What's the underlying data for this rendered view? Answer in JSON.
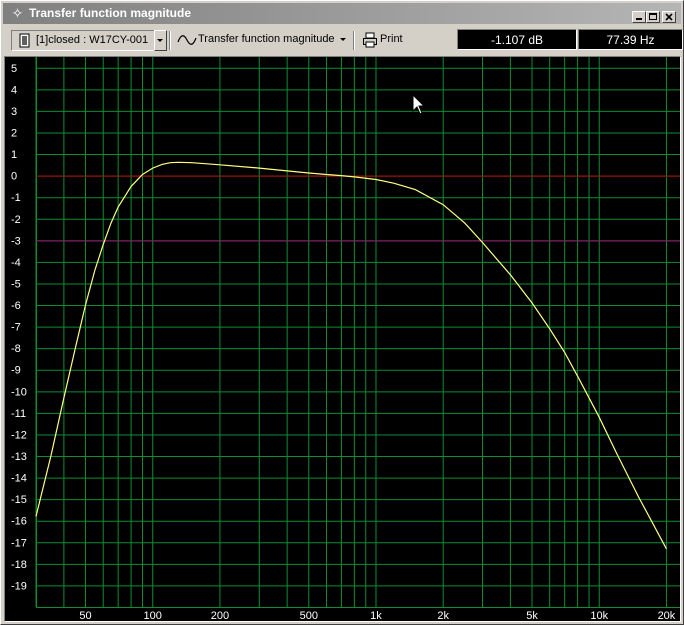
{
  "window": {
    "title": "Transfer function magnitude"
  },
  "toolbar": {
    "measurement": "[1]closed : W17CY-001",
    "view_label": "Transfer function magnitude",
    "print_label": "Print",
    "readout_db": "-1.107 dB",
    "readout_hz": "77.39 Hz"
  },
  "colors": {
    "background": "#000000",
    "grid": "#0b8f32",
    "curve": "#ffff80",
    "zero_line": "#c00000",
    "minus3_line": "#a01078",
    "labels": "#ffffff"
  },
  "chart_data": {
    "type": "line",
    "x_scale": "log",
    "xlim": [
      30,
      23000
    ],
    "ylim": [
      -20,
      5.5
    ],
    "grid": true,
    "reference_lines": [
      0,
      -3
    ],
    "y_ticks": [
      5,
      4,
      3,
      2,
      1,
      0,
      -1,
      -2,
      -3,
      -4,
      -5,
      -6,
      -7,
      -8,
      -9,
      -10,
      -11,
      -12,
      -13,
      -14,
      -15,
      -16,
      -17,
      -18,
      -19
    ],
    "y_tick_labels": [
      "5",
      "4",
      "3",
      "2",
      "1",
      "0",
      "-1",
      "-2",
      "-3",
      "-4",
      "-5",
      "-6",
      "-7",
      "-8",
      "-9",
      "-10",
      "-11",
      "-12",
      "-13",
      "-14",
      "-15",
      "-16",
      "-17",
      "-18",
      "-19"
    ],
    "x_ticks": [
      50,
      100,
      200,
      500,
      1000,
      2000,
      5000,
      10000,
      20000
    ],
    "x_tick_labels": [
      "50",
      "100",
      "200",
      "500",
      "1k",
      "2k",
      "5k",
      "10k",
      "20k"
    ],
    "series": [
      {
        "points": [
          [
            30,
            -15.8
          ],
          [
            35,
            -13.0
          ],
          [
            40,
            -10.3
          ],
          [
            45,
            -8.0
          ],
          [
            50,
            -6.0
          ],
          [
            55,
            -4.4
          ],
          [
            60,
            -3.2
          ],
          [
            65,
            -2.2
          ],
          [
            70,
            -1.45
          ],
          [
            80,
            -0.5
          ],
          [
            90,
            0.05
          ],
          [
            100,
            0.35
          ],
          [
            110,
            0.52
          ],
          [
            120,
            0.6
          ],
          [
            130,
            0.62
          ],
          [
            150,
            0.6
          ],
          [
            200,
            0.5
          ],
          [
            300,
            0.35
          ],
          [
            400,
            0.22
          ],
          [
            500,
            0.12
          ],
          [
            600,
            0.05
          ],
          [
            700,
            0.0
          ],
          [
            800,
            -0.06
          ],
          [
            1000,
            -0.18
          ],
          [
            1200,
            -0.35
          ],
          [
            1500,
            -0.65
          ],
          [
            2000,
            -1.35
          ],
          [
            2500,
            -2.2
          ],
          [
            3000,
            -3.1
          ],
          [
            4000,
            -4.6
          ],
          [
            5000,
            -5.9
          ],
          [
            6000,
            -7.1
          ],
          [
            7000,
            -8.2
          ],
          [
            8000,
            -9.3
          ],
          [
            9000,
            -10.3
          ],
          [
            10000,
            -11.2
          ],
          [
            12000,
            -12.9
          ],
          [
            15000,
            -14.9
          ],
          [
            20000,
            -17.3
          ]
        ]
      }
    ]
  }
}
